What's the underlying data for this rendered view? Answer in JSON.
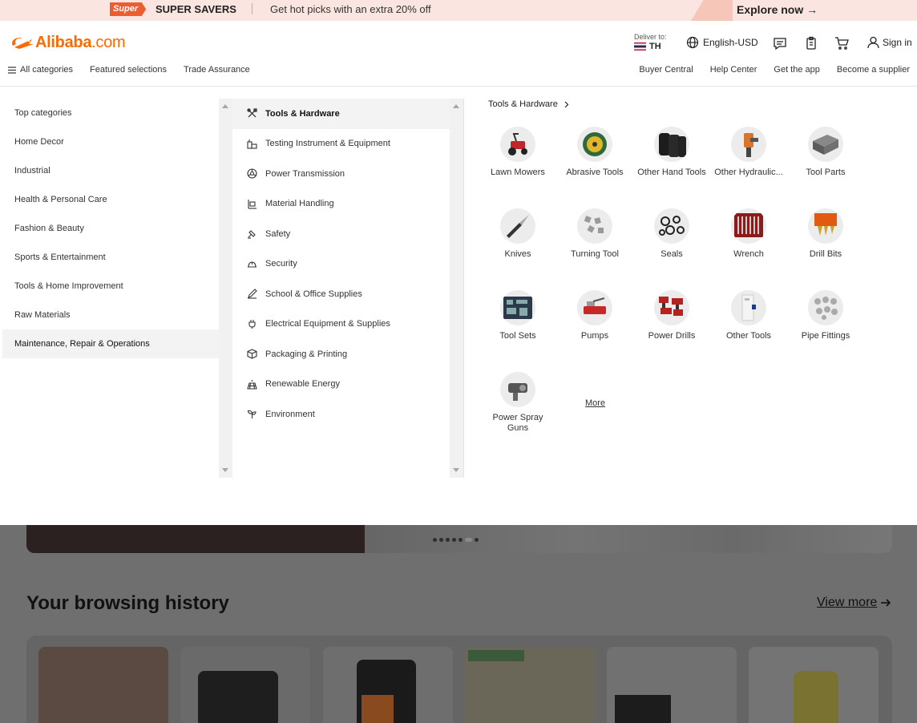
{
  "promo": {
    "badge": "Super",
    "title": "SUPER SAVERS",
    "message": "Get hot picks with an extra 20% off",
    "cta": "Explore now →"
  },
  "header": {
    "logo_text": "Alibaba",
    "logo_suffix": ".com",
    "deliver_label": "Deliver to:",
    "deliver_country": "TH",
    "language": "English-USD",
    "sign_in": "Sign in",
    "nav_left": [
      "All categories",
      "Featured selections",
      "Trade Assurance"
    ],
    "nav_right": [
      "Buyer Central",
      "Help Center",
      "Get the app",
      "Become a supplier"
    ]
  },
  "menu": {
    "top_categories": [
      "Top categories",
      "Home Decor",
      "Industrial",
      "Health & Personal Care",
      "Fashion & Beauty",
      "Sports & Entertainment",
      "Tools & Home Improvement",
      "Raw Materials",
      "Maintenance, Repair & Operations"
    ],
    "subcategories": [
      {
        "label": "Tools & Hardware",
        "icon": "tools-icon"
      },
      {
        "label": "Testing Instrument & Equipment",
        "icon": "testing-icon"
      },
      {
        "label": "Power Transmission",
        "icon": "gear-icon"
      },
      {
        "label": "Material Handling",
        "icon": "forklift-icon"
      },
      {
        "label": "Safety",
        "icon": "safety-icon"
      },
      {
        "label": "Security",
        "icon": "helmet-icon"
      },
      {
        "label": "School & Office Supplies",
        "icon": "pencil-icon"
      },
      {
        "label": "Electrical Equipment & Supplies",
        "icon": "plug-icon"
      },
      {
        "label": "Packaging & Printing",
        "icon": "box-icon"
      },
      {
        "label": "Renewable Energy",
        "icon": "solar-icon"
      },
      {
        "label": "Environment",
        "icon": "sprout-icon"
      }
    ],
    "detail_title": "Tools & Hardware",
    "products": [
      "Lawn Mowers",
      "Abrasive Tools",
      "Other Hand Tools",
      "Other Hydraulic...",
      "Tool Parts",
      "Knives",
      "Turning Tool",
      "Seals",
      "Wrench",
      "Drill Bits",
      "Tool Sets",
      "Pumps",
      "Power Drills",
      "Other Tools",
      "Pipe Fittings",
      "Power Spray Guns"
    ],
    "more": "More"
  },
  "background": {
    "history_title": "Your browsing history",
    "view_more": "View more"
  },
  "colors": {
    "brand": "#ff6a00",
    "promo_bg": "#fbe5e0",
    "badge": "#ec5d30",
    "overlay": "#6f6f6f"
  }
}
